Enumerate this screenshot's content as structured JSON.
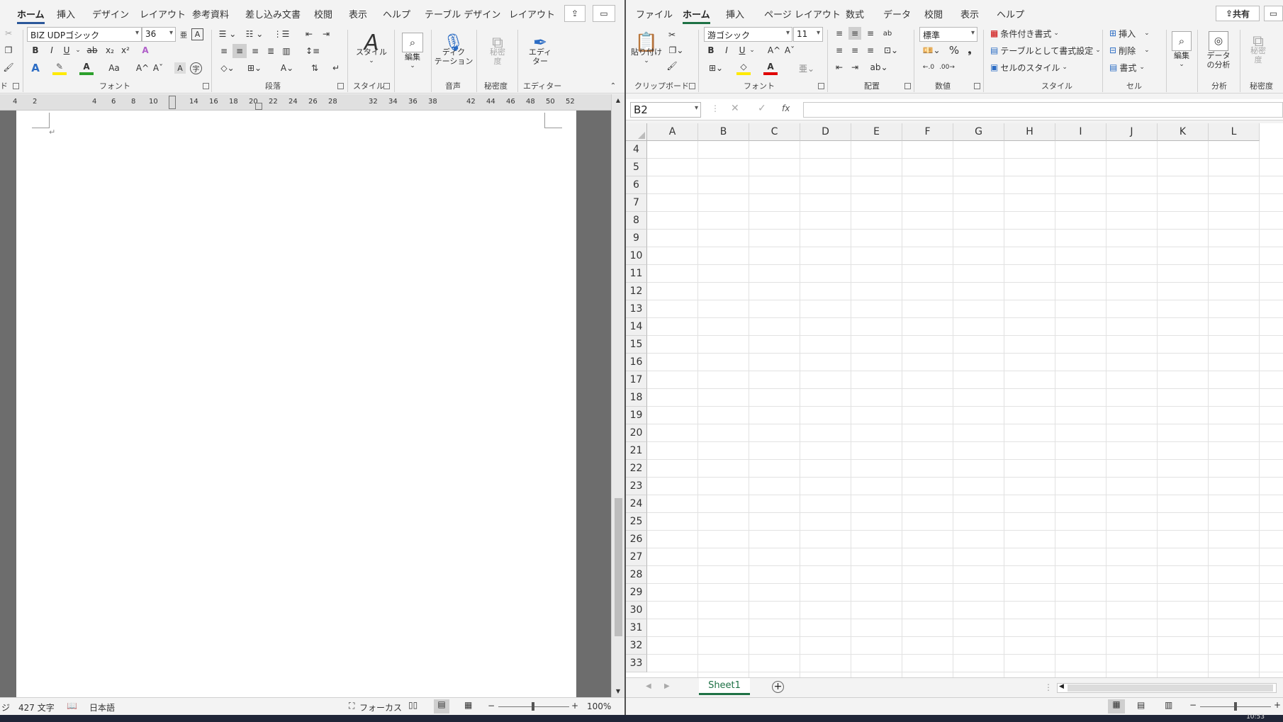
{
  "word": {
    "tabs": [
      "ホーム",
      "挿入",
      "デザイン",
      "レイアウト",
      "参考資料",
      "差し込み文書",
      "校閲",
      "表示",
      "ヘルプ",
      "テーブル デザイン",
      "レイアウト"
    ],
    "active_tab": "ホーム",
    "font": {
      "name": "BIZ UDPゴシック",
      "size": "36",
      "bold": "B",
      "italic": "I",
      "underline": "U",
      "strike": "ab",
      "sub": "x₂",
      "sup": "x²",
      "grow": "A^",
      "shrink": "Aˇ",
      "case": "Aa",
      "clear": "A"
    },
    "groups": {
      "clipboard_partial": "ド",
      "font": "フォント",
      "paragraph": "段落",
      "styles": "スタイル",
      "voice": "音声",
      "sensitivity": "秘密度",
      "editor": "エディター"
    },
    "big_buttons": {
      "style": "スタイル",
      "edit": "編集",
      "dictate_1": "ディク",
      "dictate_2": "テーション",
      "sensitivity_1": "秘密",
      "sensitivity_2": "度",
      "editor_1": "エディ",
      "editor_2": "ター"
    },
    "ruler": [
      "4",
      "2",
      "4",
      "6",
      "8",
      "10",
      "14",
      "16",
      "18",
      "20",
      "22",
      "24",
      "26",
      "28",
      "32",
      "34",
      "36",
      "38",
      "42",
      "44",
      "46",
      "48",
      "50",
      "52"
    ],
    "paragraph_mark": "↵",
    "status": {
      "page_partial": "ジ",
      "words": "427 文字",
      "lang": "日本語",
      "focus": "フォーカス",
      "zoom": "100%",
      "zoom_minus": "−",
      "zoom_plus": "+"
    }
  },
  "excel": {
    "tabs": [
      "ファイル",
      "ホーム",
      "挿入",
      "ページ レイアウト",
      "数式",
      "データ",
      "校閲",
      "表示",
      "ヘルプ"
    ],
    "active_tab": "ホーム",
    "share": "共有",
    "clipboard": {
      "paste": "貼り付け",
      "label": "クリップボード"
    },
    "font": {
      "name": "游ゴシック",
      "size": "11",
      "bold": "B",
      "italic": "I",
      "underline": "U",
      "grow": "A^",
      "shrink": "Aˇ",
      "label": "フォント"
    },
    "align": {
      "label": "配置"
    },
    "number": {
      "format": "標準",
      "percent": "%",
      "comma": "❟",
      "label": "数値"
    },
    "styles": {
      "conditional": "条件付き書式",
      "table": "テーブルとして書式設定",
      "cell": "セルのスタイル",
      "label": "スタイル"
    },
    "cells": {
      "insert": "挿入",
      "delete": "削除",
      "format": "書式",
      "label": "セル"
    },
    "edit": {
      "label": "編集"
    },
    "analysis": {
      "btn_1": "データ",
      "btn_2": "の分析",
      "label": "分析"
    },
    "sensitivity": {
      "btn_1": "秘密",
      "btn_2": "度",
      "label": "秘密度"
    },
    "namebox": "B2",
    "fx": "fx",
    "columns": [
      "A",
      "B",
      "C",
      "D",
      "E",
      "F",
      "G",
      "H",
      "I",
      "J",
      "K",
      "L"
    ],
    "rows": [
      "4",
      "5",
      "6",
      "7",
      "8",
      "9",
      "10",
      "11",
      "12",
      "13",
      "14",
      "15",
      "16",
      "17",
      "18",
      "19",
      "20",
      "21",
      "22",
      "23",
      "24",
      "25",
      "26",
      "27",
      "28",
      "29",
      "30",
      "31",
      "32",
      "33"
    ],
    "sheet": "Sheet1",
    "status_zoom_minus": "−",
    "status_zoom_plus": "+"
  },
  "taskbar": {
    "time": "10:53"
  }
}
